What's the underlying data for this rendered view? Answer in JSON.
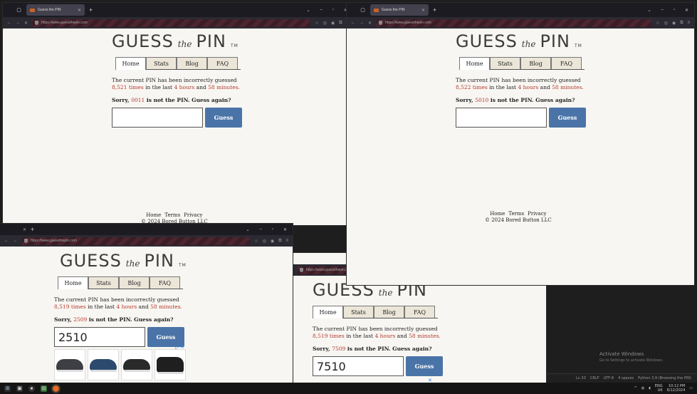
{
  "browser": {
    "tab_title": "Guess the PIN",
    "url": "https://www.guessthepin.com"
  },
  "site": {
    "logo_main": "GUESS",
    "logo_the": "the",
    "logo_pin": "PIN",
    "logo_tm": "TM",
    "nav": [
      "Home",
      "Stats",
      "Blog",
      "FAQ"
    ],
    "msg_line1": "The current PIN has been incorrectly guessed",
    "in_the_last": "in the last",
    "and": "and",
    "sorry_prefix": "Sorry,",
    "sorry_suffix": "is not the PIN. Guess again?",
    "guess_button": "Guess",
    "footer_links": [
      "Home",
      "Terms",
      "Privacy"
    ],
    "copyright": "© 2024 Bored Button LLC"
  },
  "windows": {
    "topleft": {
      "count": "8,521 times",
      "hours": "4 hours",
      "minutes": "58 minutes.",
      "last_pin": "0011",
      "input_value": ""
    },
    "topright": {
      "count": "8,522 times",
      "hours": "4 hours",
      "minutes": "58 minutes.",
      "last_pin": "5010",
      "input_value": ""
    },
    "bottomleft": {
      "count": "8,519 times",
      "hours": "4 hours",
      "minutes": "58 minutes.",
      "last_pin": "2509",
      "input_value": "2510"
    },
    "bottommid": {
      "count": "8,519 times",
      "hours": "4 hours",
      "minutes": "58 minutes.",
      "last_pin": "7509",
      "input_value": "7510"
    }
  },
  "ad": {
    "close": "✕",
    "badge": "▷"
  },
  "editor_status": [
    "Ln 33",
    "CRLF",
    "UTF-8",
    "4 spaces",
    "Python 3.9 (Browsing the PIN)"
  ],
  "activate": {
    "title": "Activate Windows",
    "sub": "Go to Settings to activate Windows."
  },
  "tray": {
    "lang": "ENG",
    "region": "UK",
    "time": "10:12 PM",
    "date": "6/12/2024"
  },
  "colors": {
    "accent_red": "#b3382c",
    "button_blue": "#4a74a8",
    "private_bar": "#4c2530"
  },
  "icons": [
    "firefox-icon",
    "start-icon",
    "search-icon",
    "task-view-icon",
    "terminal-icon"
  ]
}
